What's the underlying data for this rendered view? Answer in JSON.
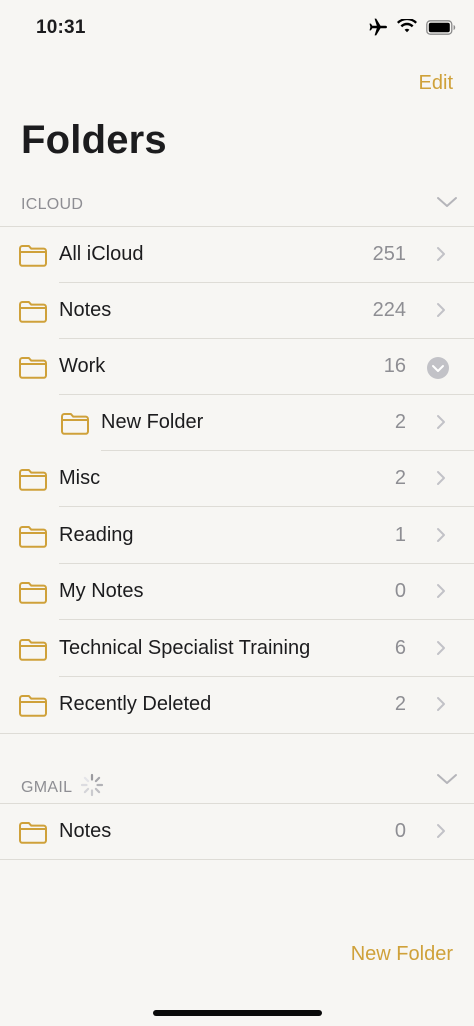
{
  "status_bar": {
    "time": "10:31",
    "icons": [
      "airplane-icon",
      "wifi-icon",
      "battery-icon"
    ]
  },
  "nav": {
    "edit_label": "Edit"
  },
  "page_title": "Folders",
  "sections": {
    "icloud": {
      "title": "ICLOUD",
      "items": [
        {
          "label": "All iCloud",
          "count": "251"
        },
        {
          "label": "Notes",
          "count": "224"
        },
        {
          "label": "Work",
          "count": "16"
        },
        {
          "label": "New Folder",
          "count": "2"
        },
        {
          "label": "Misc",
          "count": "2"
        },
        {
          "label": "Reading",
          "count": "1"
        },
        {
          "label": "My Notes",
          "count": "0"
        },
        {
          "label": "Technical Specialist Training",
          "count": "6"
        },
        {
          "label": "Recently Deleted",
          "count": "2"
        }
      ]
    },
    "gmail": {
      "title": "GMAIL",
      "items": [
        {
          "label": "Notes",
          "count": "0"
        }
      ]
    }
  },
  "toolbar": {
    "new_folder_label": "New Folder"
  },
  "colors": {
    "accent": "#cfa13a",
    "background": "#f7f6f3",
    "secondary_text": "#8e8e93",
    "separator": "#dedcd6"
  }
}
